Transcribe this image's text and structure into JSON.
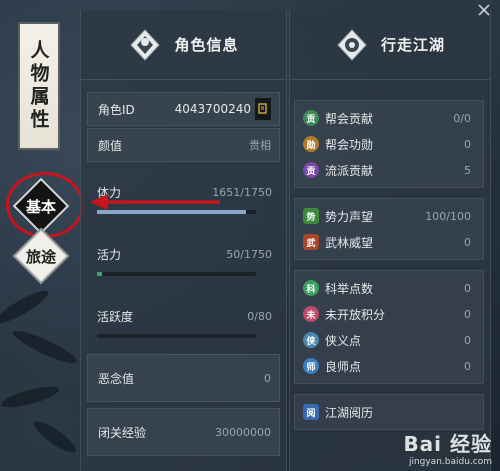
{
  "side_nav": {
    "title": "人物属性",
    "items": [
      {
        "label": "基本",
        "active": true
      },
      {
        "label": "旅途",
        "active": false
      }
    ]
  },
  "left_panel": {
    "title": "角色信息",
    "rows": [
      {
        "label": "角色ID",
        "value": "4043700240"
      },
      {
        "label": "颜值",
        "value": "贵相"
      },
      {
        "label": "体力",
        "value": "1651/1750",
        "progress": 0.94
      },
      {
        "label": "活力",
        "value": "50/1750",
        "progress": 0.03
      },
      {
        "label": "活跃度",
        "value": "0/80",
        "progress": 0
      },
      {
        "label": "恶念值",
        "value": "0"
      },
      {
        "label": "闭关经验",
        "value": "30000000"
      }
    ]
  },
  "right_panel": {
    "title": "行走江湖",
    "groups": [
      [
        {
          "icon": "贡",
          "label": "帮会贡献",
          "value": "0/0",
          "color": "#3e8a5a"
        },
        {
          "icon": "勋",
          "label": "帮会功勋",
          "value": "0",
          "color": "#b07a2a"
        },
        {
          "icon": "贡",
          "label": "流派贡献",
          "value": "5",
          "color": "#7a4aa8"
        }
      ],
      [
        {
          "icon": "势",
          "label": "势力声望",
          "value": "100/100",
          "color": "#3f8a3a"
        },
        {
          "icon": "武",
          "label": "武林威望",
          "value": "0",
          "color": "#a8452a"
        }
      ],
      [
        {
          "icon": "科",
          "label": "科举点数",
          "value": "0",
          "color": "#3aa060"
        },
        {
          "icon": "未",
          "label": "未开放积分",
          "value": "0",
          "color": "#c04a6a"
        },
        {
          "icon": "侠",
          "label": "侠义点",
          "value": "0",
          "color": "#4a8ab0"
        },
        {
          "icon": "师",
          "label": "良师点",
          "value": "0",
          "color": "#3a80c0"
        }
      ],
      [
        {
          "icon": "阅",
          "label": "江湖阅历",
          "value": "",
          "color": "#3a6ab0"
        }
      ]
    ]
  },
  "watermark": {
    "brand": "Bai 经验",
    "url": "jingyan.baidu.com"
  },
  "colors": {
    "annotation_red": "#c8141c",
    "bar_stamina": "#8aa6c8",
    "bar_vitality": "#3aa86a"
  }
}
